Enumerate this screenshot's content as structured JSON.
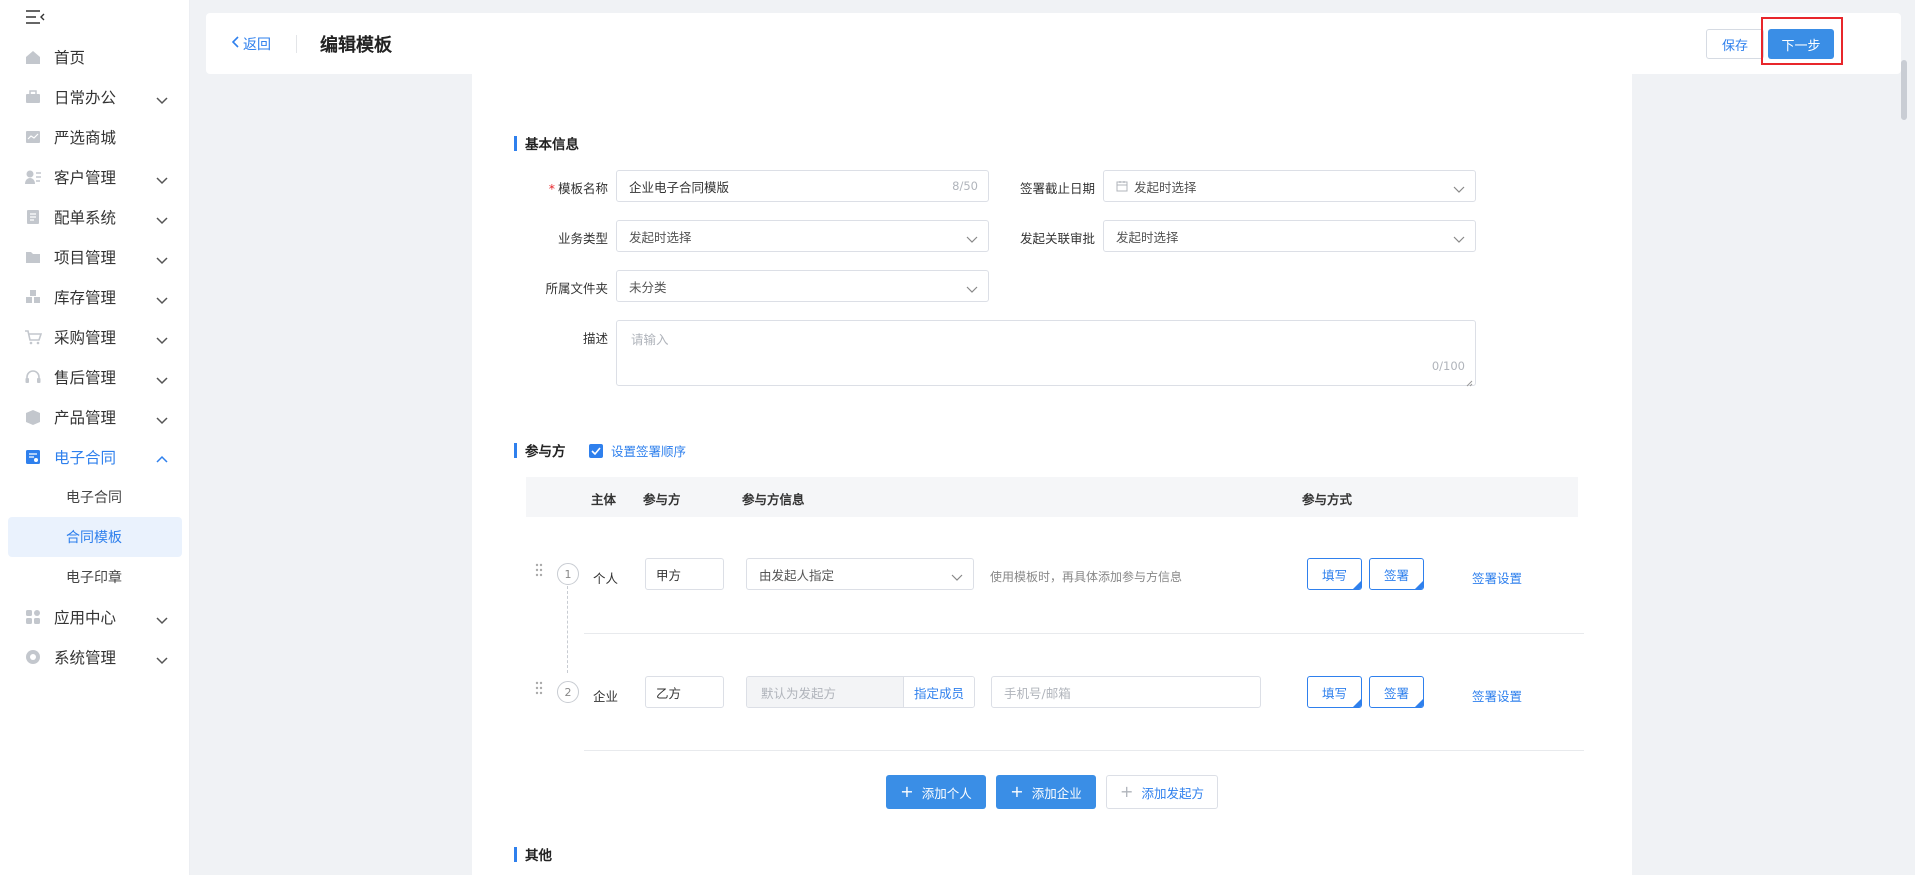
{
  "sidebar": {
    "items": [
      {
        "label": "首页",
        "icon": "home-icon",
        "has_arrow": false
      },
      {
        "label": "日常办公",
        "icon": "briefcase-icon",
        "has_arrow": true
      },
      {
        "label": "严选商城",
        "icon": "shop-icon",
        "has_arrow": false
      },
      {
        "label": "客户管理",
        "icon": "customer-icon",
        "has_arrow": true
      },
      {
        "label": "配单系统",
        "icon": "order-icon",
        "has_arrow": true
      },
      {
        "label": "项目管理",
        "icon": "folder-icon",
        "has_arrow": true
      },
      {
        "label": "库存管理",
        "icon": "inventory-icon",
        "has_arrow": true
      },
      {
        "label": "采购管理",
        "icon": "cart-icon",
        "has_arrow": true
      },
      {
        "label": "售后管理",
        "icon": "headset-icon",
        "has_arrow": true
      },
      {
        "label": "产品管理",
        "icon": "box-icon",
        "has_arrow": true
      },
      {
        "label": "电子合同",
        "icon": "contract-icon",
        "has_arrow": true,
        "active": true
      },
      {
        "label": "应用中心",
        "icon": "apps-icon",
        "has_arrow": true
      },
      {
        "label": "系统管理",
        "icon": "settings-icon",
        "has_arrow": true
      }
    ],
    "sub_items": [
      {
        "label": "电子合同",
        "active": false
      },
      {
        "label": "合同模板",
        "active": true
      },
      {
        "label": "电子印章",
        "active": false
      }
    ]
  },
  "header": {
    "back_label": "返回",
    "title": "编辑模板",
    "save_label": "保存",
    "next_label": "下一步"
  },
  "basic_info": {
    "title": "基本信息",
    "template_name_label": "模板名称",
    "template_name_value": "企业电子合同模版",
    "template_name_counter": "8/50",
    "deadline_label": "签署截止日期",
    "deadline_value": "发起时选择",
    "business_type_label": "业务类型",
    "business_type_value": "发起时选择",
    "related_approval_label": "发起关联审批",
    "related_approval_value": "发起时选择",
    "folder_label": "所属文件夹",
    "folder_value": "未分类",
    "description_label": "描述",
    "description_placeholder": "请输入",
    "description_counter": "0/100"
  },
  "participants": {
    "title": "参与方",
    "order_checkbox_label": "设置签署顺序",
    "order_checked": true,
    "columns": [
      "主体",
      "参与方",
      "参与方信息",
      "参与方式"
    ],
    "rows": [
      {
        "order": "1",
        "subject": "个人",
        "party": "甲方",
        "info_select": "由发起人指定",
        "info_hint": "使用模板时，再具体添加参与方信息",
        "fill_label": "填写",
        "sign_label": "签署",
        "settings_label": "签署设置"
      },
      {
        "order": "2",
        "subject": "企业",
        "party": "乙方",
        "info_default": "默认为发起方",
        "info_assign": "指定成员",
        "info_contact_placeholder": "手机号/邮箱",
        "fill_label": "填写",
        "sign_label": "签署",
        "settings_label": "签署设置"
      }
    ],
    "add_person_label": "添加个人",
    "add_company_label": "添加企业",
    "add_initiator_label": "添加发起方"
  },
  "other": {
    "title": "其他"
  },
  "colors": {
    "accent": "#2f80ed",
    "primary_button": "#3a8ee6",
    "highlight_border": "#e8262b",
    "required": "#e8262b"
  }
}
